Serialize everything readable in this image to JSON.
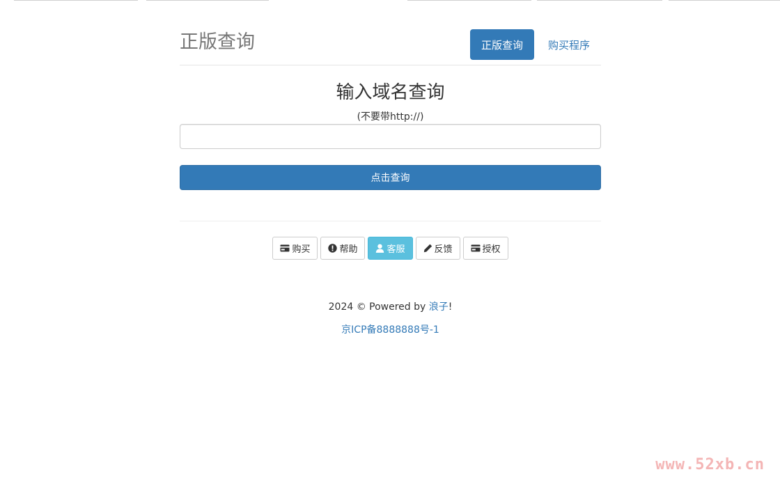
{
  "header": {
    "brand": "正版查询",
    "nav": [
      {
        "label": "正版查询",
        "active": true
      },
      {
        "label": "购买程序",
        "active": false
      }
    ]
  },
  "query": {
    "title": "输入域名查询",
    "hint": "(不要带http://)",
    "input_value": "",
    "submit_label": "点击查询"
  },
  "tools": [
    {
      "icon": "credit-card-icon",
      "label": "购买"
    },
    {
      "icon": "exclamation-circle-icon",
      "label": "帮助"
    },
    {
      "icon": "user-icon",
      "label": "客服"
    },
    {
      "icon": "pencil-icon",
      "label": "反馈"
    },
    {
      "icon": "credit-card-icon",
      "label": "授权"
    }
  ],
  "footer": {
    "copyright_prefix": "2024 © Powered by ",
    "author": "浪子",
    "copyright_suffix": "!",
    "icp": "京ICP备8888888号-1"
  },
  "watermark": "www.52xb.cn",
  "colors": {
    "primary": "#337ab7",
    "info": "#5bc0de",
    "brand_text": "#777777"
  }
}
